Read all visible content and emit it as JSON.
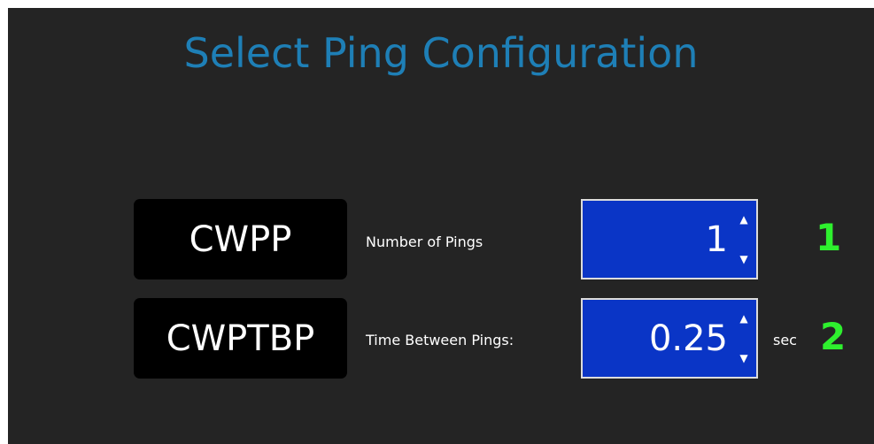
{
  "title": "Select Ping Configuration",
  "rows": [
    {
      "code": "CWPP",
      "label": "Number of Pings",
      "value": "1",
      "unit": "",
      "step": "1"
    },
    {
      "code": "CWPTBP",
      "label": "Time Between Pings:",
      "value": "0.25",
      "unit": "sec",
      "step": "2"
    }
  ],
  "icons": {
    "up": "caret-up-icon",
    "down": "caret-down-icon"
  },
  "colors": {
    "background": "#242424",
    "title": "#1e7fb6",
    "spinner_bg": "#0a35c6",
    "step_number": "#2ef02e"
  }
}
